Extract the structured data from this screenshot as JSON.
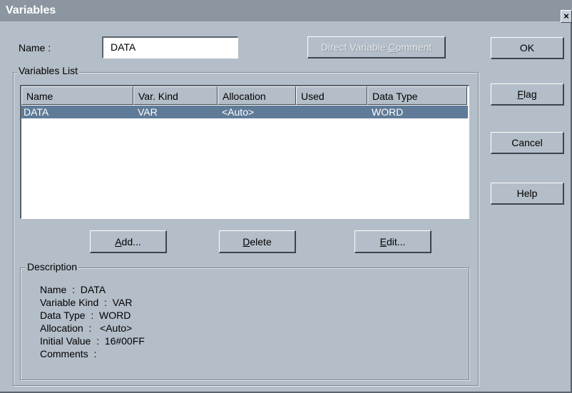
{
  "window": {
    "title": "Variables",
    "close_glyph": "×"
  },
  "name_field": {
    "label": "Name :",
    "value": "DATA"
  },
  "buttons": {
    "direct_variable_comment": {
      "pre": "Direct Variable ",
      "accel": "C",
      "post": "omment"
    },
    "ok": {
      "pre": "",
      "accel": "",
      "post": "OK"
    },
    "flag": {
      "pre": "",
      "accel": "F",
      "post": "lag"
    },
    "cancel": {
      "pre": "",
      "accel": "",
      "post": "Cancel"
    },
    "help": {
      "pre": "",
      "accel": "",
      "post": "Help"
    },
    "add": {
      "pre": "",
      "accel": "A",
      "post": "dd..."
    },
    "delete": {
      "pre": "",
      "accel": "D",
      "post": "elete"
    },
    "edit": {
      "pre": "",
      "accel": "E",
      "post": "dit..."
    }
  },
  "variables_list": {
    "group_label": "Variables List",
    "columns": [
      "Name",
      "Var. Kind",
      "Allocation",
      "Used",
      "Data Type"
    ],
    "rows": [
      {
        "name": "DATA",
        "var_kind": "VAR",
        "allocation": "<Auto>",
        "used": "",
        "data_type": "WORD",
        "selected": true
      }
    ]
  },
  "description": {
    "group_label": "Description",
    "lines": [
      "Name  :  DATA",
      "Variable Kind  :  VAR",
      "Data Type  :  WORD",
      "Allocation  :   <Auto>",
      "Initial Value  :  16#00FF",
      "Comments  :"
    ]
  },
  "colors": {
    "face": "#b4bec8",
    "selection": "#5f7b97",
    "titlebar": "#8c96a0"
  }
}
